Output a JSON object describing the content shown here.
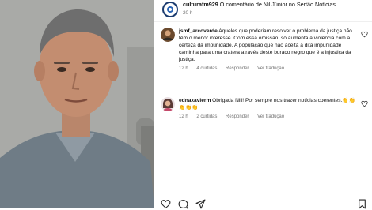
{
  "post": {
    "username": "culturafm929",
    "caption": "O comentário de Nil Júnior no Sertão Notícias",
    "time": "20 h"
  },
  "comments": [
    {
      "username": "jsmf_arcoverde",
      "text": "Aqueles que poderiam resolver o problema da justiça não têm o menor interesse. Com essa omissão, só aumenta a violência com a certeza da impunidade. A população que não aceita a dita impunidade caminha para uma cratera através deste buraco negro que é a injustiça da justiça.",
      "time": "12 h",
      "likes": "4 curtidas",
      "reply": "Responder",
      "translate": "Ver tradução"
    },
    {
      "username": "ednaxavierm",
      "text": "Obrigada Nill! Por sempre nos trazer notícias coerentes.👏👏👏👏👏",
      "time": "12 h",
      "likes": "2 curtidas",
      "reply": "Responder",
      "translate": "Ver tradução"
    }
  ],
  "icons": {
    "like": "heart-icon",
    "comment": "comment-icon",
    "share": "share-icon",
    "save": "bookmark-icon"
  }
}
